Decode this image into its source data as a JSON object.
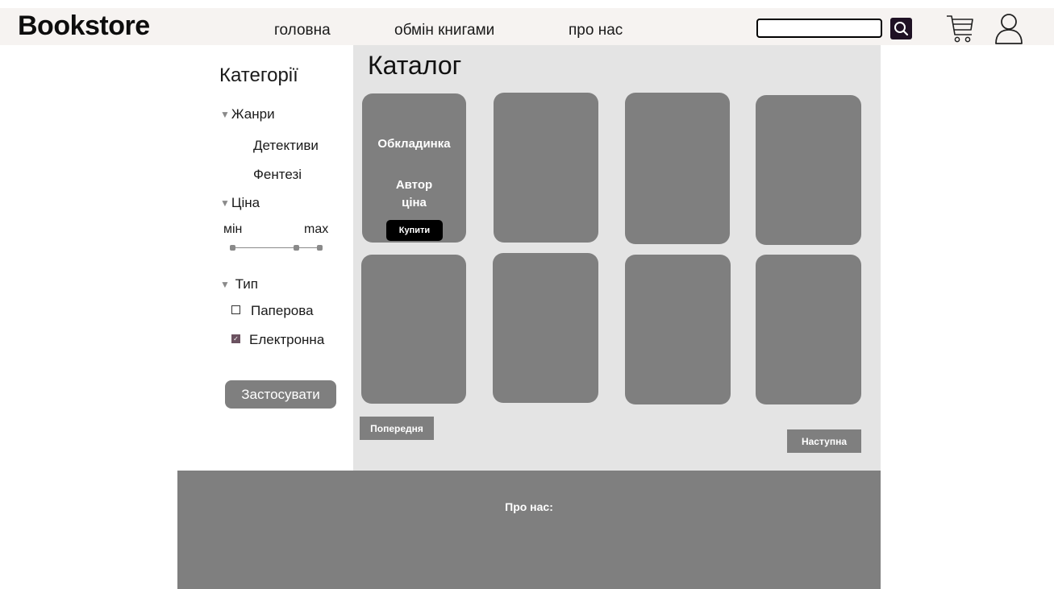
{
  "header": {
    "logo": "Bookstore",
    "nav": [
      "головна",
      "обмін книгами",
      "про нас"
    ],
    "search": {
      "value": "",
      "placeholder": ""
    },
    "icons": [
      "search-icon",
      "cart-icon",
      "user-icon"
    ]
  },
  "sidebar": {
    "title": "Категорії",
    "genres": {
      "label": "Жанри",
      "items": [
        "Детективи",
        "Фентезі"
      ]
    },
    "price": {
      "label": "Ціна",
      "min_label": "мін",
      "max_label": "max"
    },
    "type": {
      "label": "Тип",
      "options": [
        {
          "label": "Паперова",
          "checked": false
        },
        {
          "label": "Електронна",
          "checked": true
        }
      ]
    },
    "apply_label": "Застосувати"
  },
  "catalog": {
    "title": "Каталог",
    "first_card": {
      "cover": "Обкладинка",
      "author": "Автор",
      "price": "ціна",
      "buy_label": "Купити"
    },
    "prev_label": "Попередня",
    "next_label": "Наступна"
  },
  "footer": {
    "title": "Про нас:"
  },
  "colors": {
    "card": "#7f7f7f",
    "panel": "#e4e4e4",
    "header": "#f6f3f1",
    "search_button": "#1f1124",
    "buy_button": "#000000"
  }
}
